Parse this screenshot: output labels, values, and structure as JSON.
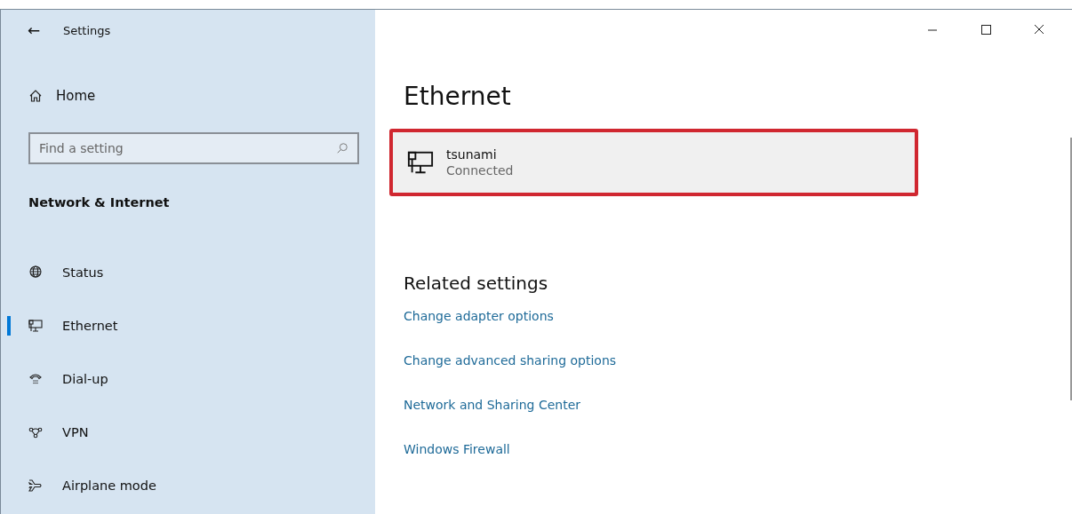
{
  "window": {
    "title": "Settings",
    "back": "←"
  },
  "sidebar": {
    "home": {
      "label": "Home"
    },
    "search": {
      "placeholder": "Find a setting"
    },
    "section": "Network & Internet",
    "items": [
      {
        "label": "Status",
        "kind": "globe",
        "selected": false
      },
      {
        "label": "Ethernet",
        "kind": "ethernet",
        "selected": true
      },
      {
        "label": "Dial-up",
        "kind": "phone",
        "selected": false
      },
      {
        "label": "VPN",
        "kind": "vpn",
        "selected": false
      },
      {
        "label": "Airplane mode",
        "kind": "airplane",
        "selected": false
      }
    ]
  },
  "main": {
    "heading": "Ethernet",
    "connection": {
      "name": "tsunami",
      "status": "Connected",
      "highlighted": true
    },
    "related": {
      "heading": "Related settings",
      "links": [
        "Change adapter options",
        "Change advanced sharing options",
        "Network and Sharing Center",
        "Windows Firewall"
      ]
    }
  }
}
